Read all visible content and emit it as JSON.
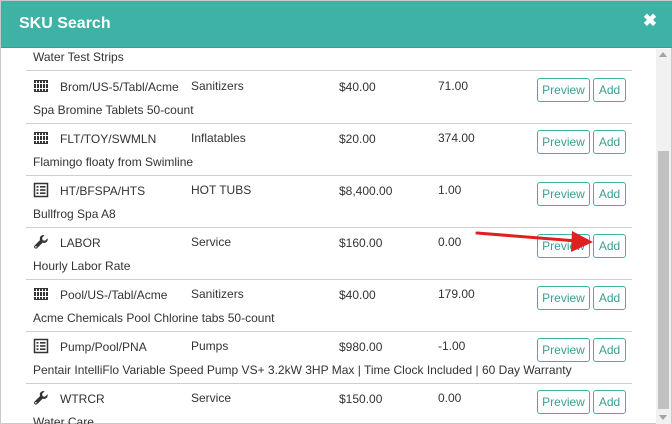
{
  "dialog": {
    "title": "SKU Search",
    "close_symbol": "✖",
    "header_color": "#3eb2a4"
  },
  "top_fragment": {
    "description": "Water Test Strips"
  },
  "items": [
    {
      "icon": "barcode-icon",
      "sku": "Brom/US-5/Tabl/Acme",
      "category": "Sanitizers",
      "price": "$40.00",
      "qty": "71.00",
      "description": "Spa Bromine Tablets 50-count",
      "preview_label": "Preview",
      "add_label": "Add"
    },
    {
      "icon": "barcode-icon",
      "sku": "FLT/TOY/SWMLN",
      "category": "Inflatables",
      "price": "$20.00",
      "qty": "374.00",
      "description": "Flamingo floaty from Swimline",
      "preview_label": "Preview",
      "add_label": "Add"
    },
    {
      "icon": "list-icon",
      "sku": "HT/BFSPA/HTS",
      "category": "HOT TUBS",
      "price": "$8,400.00",
      "qty": "1.00",
      "description": "Bullfrog Spa A8",
      "preview_label": "Preview",
      "add_label": "Add"
    },
    {
      "icon": "wrench-icon",
      "sku": "LABOR",
      "category": "Service",
      "price": "$160.00",
      "qty": "0.00",
      "description": "Hourly Labor Rate",
      "preview_label": "Preview",
      "add_label": "Add"
    },
    {
      "icon": "barcode-icon",
      "sku": "Pool/US-/Tabl/Acme",
      "category": "Sanitizers",
      "price": "$40.00",
      "qty": "179.00",
      "description": "Acme Chemicals Pool Chlorine tabs 50-count",
      "preview_label": "Preview",
      "add_label": "Add"
    },
    {
      "icon": "list-icon",
      "sku": "Pump/Pool/PNA",
      "category": "Pumps",
      "price": "$980.00",
      "qty": "-1.00",
      "description": "Pentair IntelliFlo Variable Speed Pump VS+ 3.2kW 3HP Max | Time Clock Included | 60 Day Warranty",
      "preview_label": "Preview",
      "add_label": "Add"
    },
    {
      "icon": "wrench-icon",
      "sku": "WTRCR",
      "category": "Service",
      "price": "$150.00",
      "qty": "0.00",
      "description": "Water Care",
      "preview_label": "Preview",
      "add_label": "Add"
    }
  ],
  "colors": {
    "accent": "#3eb2a4",
    "button_text": "#3a9e92",
    "annotation_arrow": "#e02020"
  }
}
